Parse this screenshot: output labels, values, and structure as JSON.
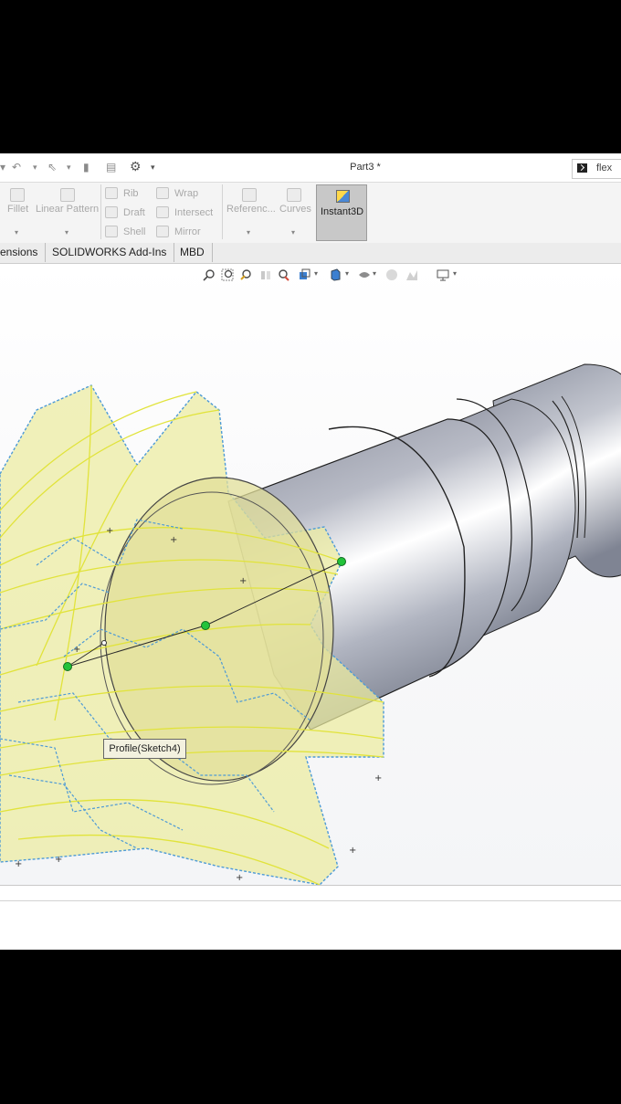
{
  "window": {
    "title": "Part3 *",
    "search_text": "flex"
  },
  "ribbon": {
    "fillet": "Fillet",
    "linear_pattern": "Linear Pattern",
    "rib": "Rib",
    "draft": "Draft",
    "shell": "Shell",
    "wrap": "Wrap",
    "intersect": "Intersect",
    "mirror": "Mirror",
    "reference": "Referenc...",
    "curves": "Curves",
    "instant3d": "Instant3D"
  },
  "tabs": [
    {
      "label": "ensions"
    },
    {
      "label": "SOLIDWORKS Add-Ins"
    },
    {
      "label": "MBD"
    }
  ],
  "viewport": {
    "profile_label": "Profile(Sketch4)"
  },
  "colors": {
    "sketch_blue": "#4d9ad6",
    "preview_yellow": "#eeef9a",
    "edge_yellow": "#e4e63a",
    "shaft_grey": "#b8bbc3",
    "handle_green": "#22c33a"
  }
}
